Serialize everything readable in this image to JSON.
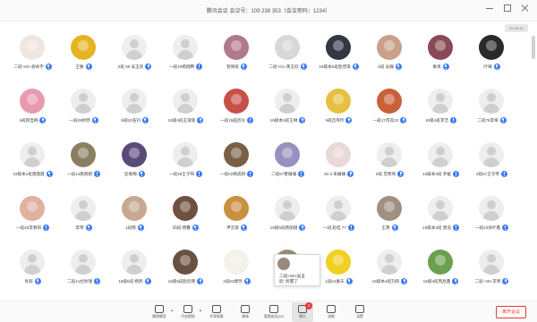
{
  "window": {
    "title": "腾讯会议 会议号：109 238 353（会议密码：1234）"
  },
  "timer": "01:23:12",
  "participants": [
    {
      "name": "二班+62+袁咏宇",
      "avatar": "photo",
      "color": "#f0e6e0"
    },
    {
      "name": "王敏",
      "avatar": "photo",
      "color": "#e6b422"
    },
    {
      "name": "2班 59 吴玉欣",
      "avatar": "default",
      "color": ""
    },
    {
      "name": "一班40杨翔腾",
      "avatar": "default",
      "color": ""
    },
    {
      "name": "管佩纸",
      "avatar": "photo",
      "color": "#b07a8a"
    },
    {
      "name": "二班+01+黄玉欣",
      "avatar": "photo",
      "color": "#d8d8d8"
    },
    {
      "name": "16级本5班赵佳琪",
      "avatar": "photo",
      "color": "#333744"
    },
    {
      "name": "5班 吴巍",
      "avatar": "photo",
      "color": "#c9a08a"
    },
    {
      "name": "秦清",
      "avatar": "photo",
      "color": "#8a4a55"
    },
    {
      "name": "叶琳",
      "avatar": "photo",
      "color": "#2a2a2a"
    },
    {
      "name": "5班邱显梅",
      "avatar": "photo",
      "color": "#e89ab0"
    },
    {
      "name": "一班29娇郭",
      "avatar": "default",
      "color": ""
    },
    {
      "name": "5班52浩刘",
      "avatar": "default",
      "color": ""
    },
    {
      "name": "16级4班王淑丽",
      "avatar": "default",
      "color": ""
    },
    {
      "name": "一班15画吕仪",
      "avatar": "photo",
      "color": "#c8504a"
    },
    {
      "name": "16级本4班王琳",
      "avatar": "default",
      "color": ""
    },
    {
      "name": "5班吕燕玲",
      "avatar": "photo",
      "color": "#e8c040"
    },
    {
      "name": "一班17芮蕊22",
      "avatar": "photo",
      "color": "#c8603a"
    },
    {
      "name": "16级4班李洁",
      "avatar": "default",
      "color": ""
    },
    {
      "name": "二班76李将",
      "avatar": "default",
      "color": ""
    },
    {
      "name": "16级本1班唐霞霞",
      "avatar": "default",
      "color": ""
    },
    {
      "name": "一班14施晓婉",
      "avatar": "photo",
      "color": "#8a8060"
    },
    {
      "name": "彭春梅",
      "avatar": "photo",
      "color": "#5a4a7a"
    },
    {
      "name": "一班35王子琦",
      "avatar": "default",
      "color": ""
    },
    {
      "name": "一班02杨成妍",
      "avatar": "photo",
      "color": "#7a6048"
    },
    {
      "name": "二班57曹珊珊",
      "avatar": "photo",
      "color": "#9a90c0"
    },
    {
      "name": "16-3 朱姗姗",
      "avatar": "photo",
      "color": "#e8d8d8"
    },
    {
      "name": "5班 范青燕",
      "avatar": "default",
      "color": ""
    },
    {
      "name": "16级本4班 罗媛",
      "avatar": "default",
      "color": ""
    },
    {
      "name": "2班67王守琴",
      "avatar": "default",
      "color": ""
    },
    {
      "name": "一班26李春阳",
      "avatar": "photo",
      "color": "#e0b0a0"
    },
    {
      "name": "李琴",
      "avatar": "default",
      "color": ""
    },
    {
      "name": "1班杨",
      "avatar": "photo",
      "color": "#c8a890"
    },
    {
      "name": "四班 杨馨",
      "avatar": "photo",
      "color": "#705040"
    },
    {
      "name": "尹云蓉",
      "avatar": "photo",
      "color": "#c89040"
    },
    {
      "name": "16级5班杨丽翔",
      "avatar": "default",
      "color": ""
    },
    {
      "name": "一班 赵桂 77",
      "avatar": "default",
      "color": ""
    },
    {
      "name": "王艳",
      "avatar": "photo",
      "color": "#a09080"
    },
    {
      "name": "16级本4班 唐浩",
      "avatar": "default",
      "color": ""
    },
    {
      "name": "一班23徐叶鑫",
      "avatar": "default",
      "color": ""
    },
    {
      "name": "肖丽",
      "avatar": "default",
      "color": ""
    },
    {
      "name": "二班41杜秋瑞",
      "avatar": "default",
      "color": ""
    },
    {
      "name": "16级5班 杨燕",
      "avatar": "default",
      "color": ""
    },
    {
      "name": "16级5班赵欣雨",
      "avatar": "photo",
      "color": "#6a5040"
    },
    {
      "name": "2班63唐玲",
      "avatar": "photo",
      "color": "#f4f0ea"
    },
    {
      "name": "",
      "avatar": "photo",
      "color": "#9a8a7a"
    },
    {
      "name": "1班01秦天",
      "avatar": "photo",
      "color": "#f0d020"
    },
    {
      "name": "16级本4班刘燕",
      "avatar": "default",
      "color": ""
    },
    {
      "name": "16级4班周昌鑫",
      "avatar": "photo",
      "color": "#6aa050"
    },
    {
      "name": "二班+49+李青",
      "avatar": "default",
      "color": ""
    }
  ],
  "chat_popup": {
    "text": "二班+03+吴玉欣: 听累了"
  },
  "toolbar": {
    "tools": [
      {
        "label": "解除静音",
        "icon": "mic-off-icon",
        "caret": "▲"
      },
      {
        "label": "开启视频",
        "icon": "camera-icon",
        "caret": "▲"
      },
      {
        "label": "共享屏幕",
        "icon": "screen-share-icon",
        "caret": ""
      },
      {
        "label": "邀请",
        "icon": "invite-icon",
        "caret": ""
      },
      {
        "label": "管理成员(50)",
        "icon": "members-icon",
        "caret": ""
      },
      {
        "label": "聊天",
        "icon": "chat-icon",
        "caret": "",
        "badge": "1"
      },
      {
        "label": "录制",
        "icon": "record-icon",
        "caret": ""
      },
      {
        "label": "设置",
        "icon": "settings-icon",
        "caret": ""
      }
    ],
    "end_label": "离开会议"
  },
  "colors": {
    "accent": "#3d7bf7",
    "danger": "#e53935"
  }
}
